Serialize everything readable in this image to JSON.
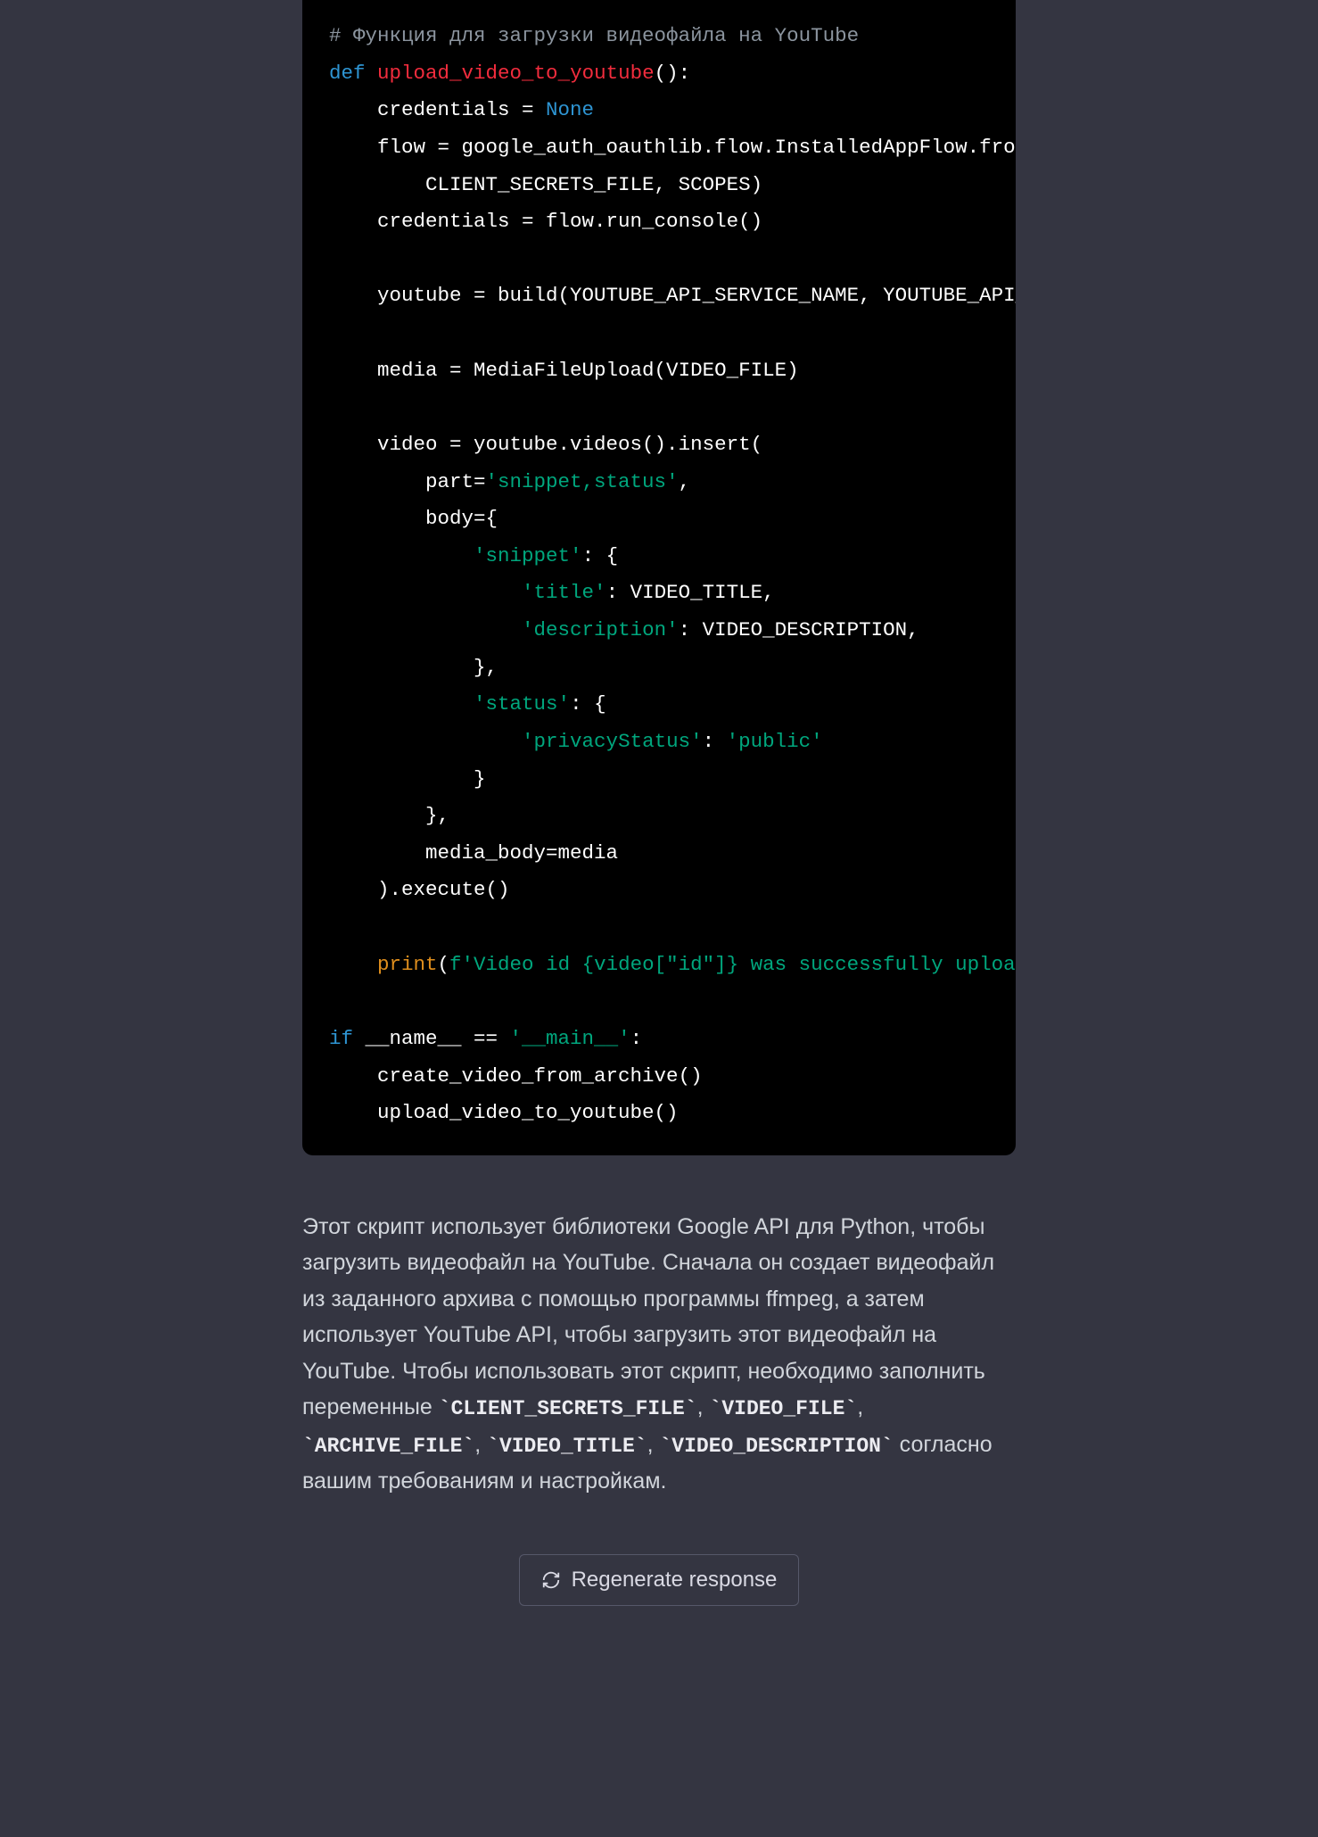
{
  "code": {
    "line01_comment": "# Функция для загрузки видеофайла на YouTube",
    "line02_def": "def",
    "line02_fn": "upload_video_to_youtube",
    "line02_tail": "():",
    "line03": "    credentials = ",
    "line03_none": "None",
    "line04": "    flow = google_auth_oauthlib.flow.InstalledAppFlow.from_client",
    "line05": "        CLIENT_SECRETS_FILE, SCOPES)",
    "line06": "    credentials = flow.run_console()",
    "line08": "    youtube = build(YOUTUBE_API_SERVICE_NAME, YOUTUBE_API_VERSION",
    "line10": "    media = MediaFileUpload(VIDEO_FILE)",
    "line12": "    video = youtube.videos().insert(",
    "line13a": "        part=",
    "line13b": "'snippet,status'",
    "line13c": ",",
    "line14": "        body={",
    "line15a": "            ",
    "line15b": "'snippet'",
    "line15c": ": {",
    "line16a": "                ",
    "line16b": "'title'",
    "line16c": ": VIDEO_TITLE,",
    "line17a": "                ",
    "line17b": "'description'",
    "line17c": ": VIDEO_DESCRIPTION,",
    "line18": "            },",
    "line19a": "            ",
    "line19b": "'status'",
    "line19c": ": {",
    "line20a": "                ",
    "line20b": "'privacyStatus'",
    "line20c": ": ",
    "line20d": "'public'",
    "line21": "            }",
    "line22": "        },",
    "line23": "        media_body=media",
    "line24": "    ).execute()",
    "line26a": "    ",
    "line26_print": "print",
    "line26b": "(",
    "line26c": "f'Video id {video[\"id\"]} was successfully uploaded.'",
    "line26d": ")",
    "line28_if": "if",
    "line28a": " __name__ == ",
    "line28b": "'__main__'",
    "line28c": ":",
    "line29": "    create_video_from_archive()",
    "line30": "    upload_video_to_youtube()"
  },
  "explain": {
    "p1a": "Этот скрипт использует библиотеки Google API для Python, чтобы загрузить видеофайл на YouTube. Сначала он создает видеофайл из заданного архива с помощью программы ffmpeg, а затем использует YouTube API, чтобы загрузить этот видеофайл на YouTube. Чтобы использовать этот скрипт, необходимо заполнить переменные ",
    "v1": "`CLIENT_SECRETS_FILE`",
    "s1": ", ",
    "v2": "`VIDEO_FILE`",
    "s2": ", ",
    "v3": "`ARCHIVE_FILE`",
    "s3": ", ",
    "v4": "`VIDEO_TITLE`",
    "s4": ", ",
    "v5": "`VIDEO_DESCRIPTION`",
    "p1b": " согласно вашим требованиям и настройкам."
  },
  "regen": {
    "label": "Regenerate response"
  }
}
